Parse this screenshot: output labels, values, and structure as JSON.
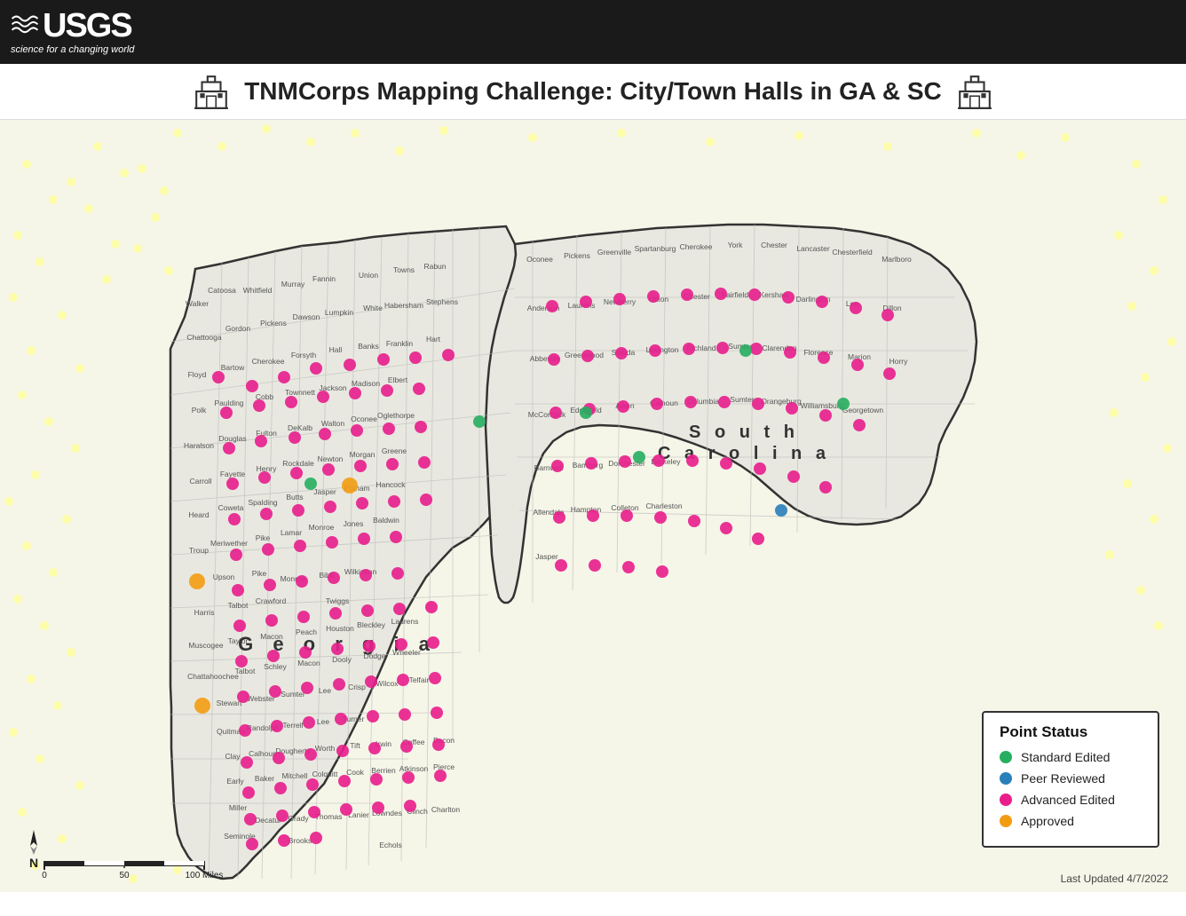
{
  "header": {
    "usgs_name": "USGS",
    "tagline": "science for a changing world"
  },
  "title": {
    "text": "TNMCorps Mapping Challenge: City/Town Halls in GA & SC",
    "icon_label": "building-icon"
  },
  "legend": {
    "title": "Point Status",
    "items": [
      {
        "label": "Standard Edited",
        "color": "#2ecc71",
        "dot_color": "#27ae60"
      },
      {
        "label": "Peer Reviewed",
        "color": "#3498db",
        "dot_color": "#2980b9"
      },
      {
        "label": "Advanced Edited",
        "color": "#e91e8c",
        "dot_color": "#c2185b"
      },
      {
        "label": "Approved",
        "color": "#f1c40f",
        "dot_color": "#f39c12"
      }
    ]
  },
  "map": {
    "states": [
      "Georgia",
      "South Carolina"
    ],
    "georgia_label": "G e o r g i a",
    "sc_label": "S o u t h\nC a r o l i n a"
  },
  "scale": {
    "label": "100 Miles",
    "ticks": [
      "0",
      "50",
      "100"
    ]
  },
  "footer": {
    "last_updated": "Last Updated 4/7/2022"
  }
}
